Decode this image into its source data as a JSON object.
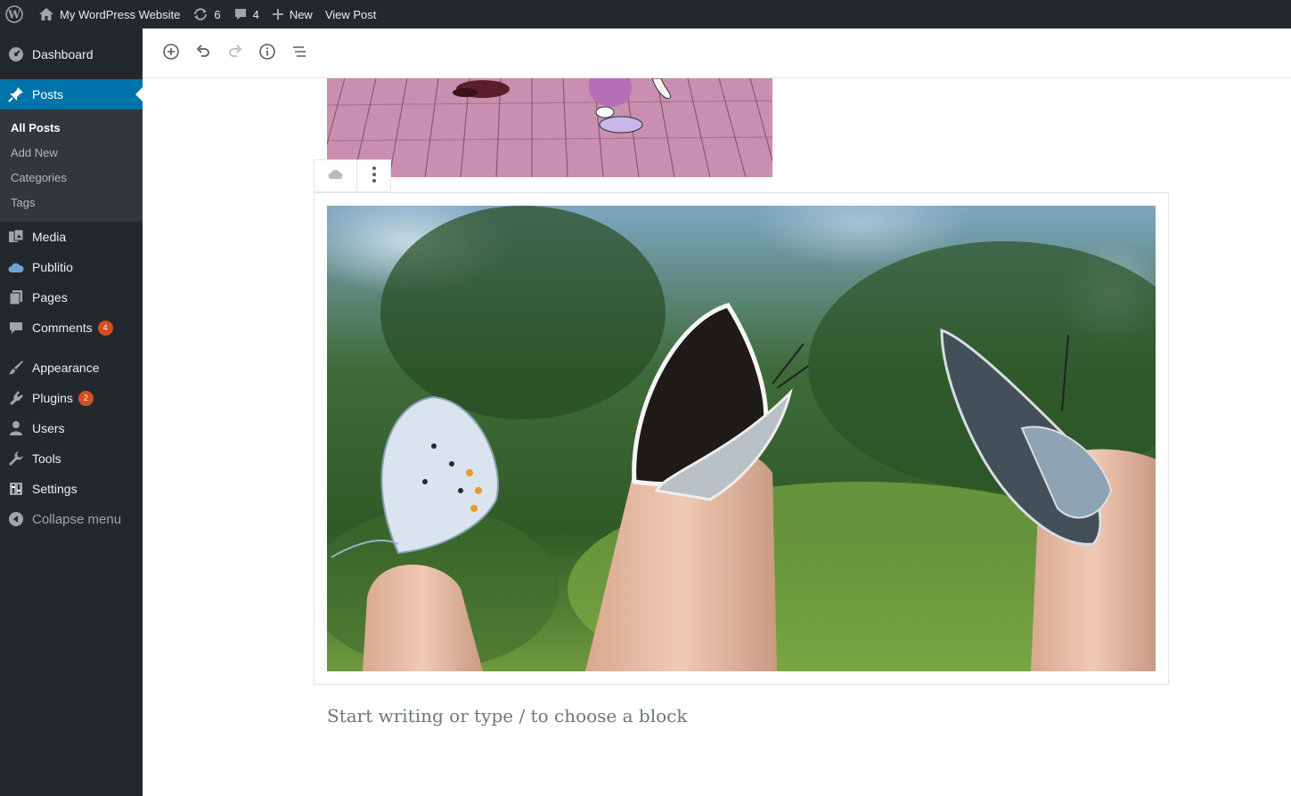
{
  "admin_bar": {
    "site_name": "My WordPress Website",
    "updates_count": "6",
    "comments_count": "4",
    "new_label": "New",
    "view_post_label": "View Post"
  },
  "sidebar": {
    "dashboard": "Dashboard",
    "posts": "Posts",
    "posts_submenu": [
      "All Posts",
      "Add New",
      "Categories",
      "Tags"
    ],
    "media": "Media",
    "publitio": "Publitio",
    "pages": "Pages",
    "comments": "Comments",
    "comments_badge": "4",
    "appearance": "Appearance",
    "plugins": "Plugins",
    "plugins_badge": "2",
    "users": "Users",
    "tools": "Tools",
    "settings": "Settings",
    "collapse": "Collapse menu"
  },
  "editor": {
    "toolbar_icons": [
      "add-block-icon",
      "undo-icon",
      "redo-icon",
      "info-icon",
      "block-navigation-icon"
    ],
    "block_toolbar_icons": [
      "cloud-icon",
      "more-options-icon"
    ],
    "appender_placeholder": "Start writing or type / to choose a block"
  },
  "colors": {
    "admin_dark": "#23282d",
    "submenu_bg": "#32373c",
    "accent": "#0073aa",
    "badge": "#d54e21"
  }
}
